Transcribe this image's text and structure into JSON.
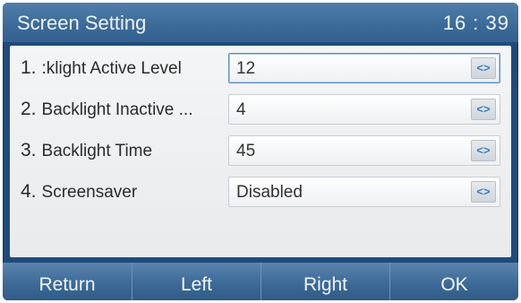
{
  "title_bar": {
    "title": "Screen Setting",
    "time": "16 : 39"
  },
  "settings": [
    {
      "number": "1.",
      "label": ":klight Active Level",
      "value": "12"
    },
    {
      "number": "2.",
      "label": "Backlight Inactive ...",
      "value": "4"
    },
    {
      "number": "3.",
      "label": "Backlight Time",
      "value": "45"
    },
    {
      "number": "4.",
      "label": "Screensaver",
      "value": "Disabled"
    }
  ],
  "selector_glyph": "<>",
  "softkeys": {
    "return": "Return",
    "left": "Left",
    "right": "Right",
    "ok": "OK"
  },
  "colors": {
    "title_bar": "#3c6a98",
    "selection_accent": "#5b8fc6",
    "arrow_glyph": "#3f7fc0"
  }
}
